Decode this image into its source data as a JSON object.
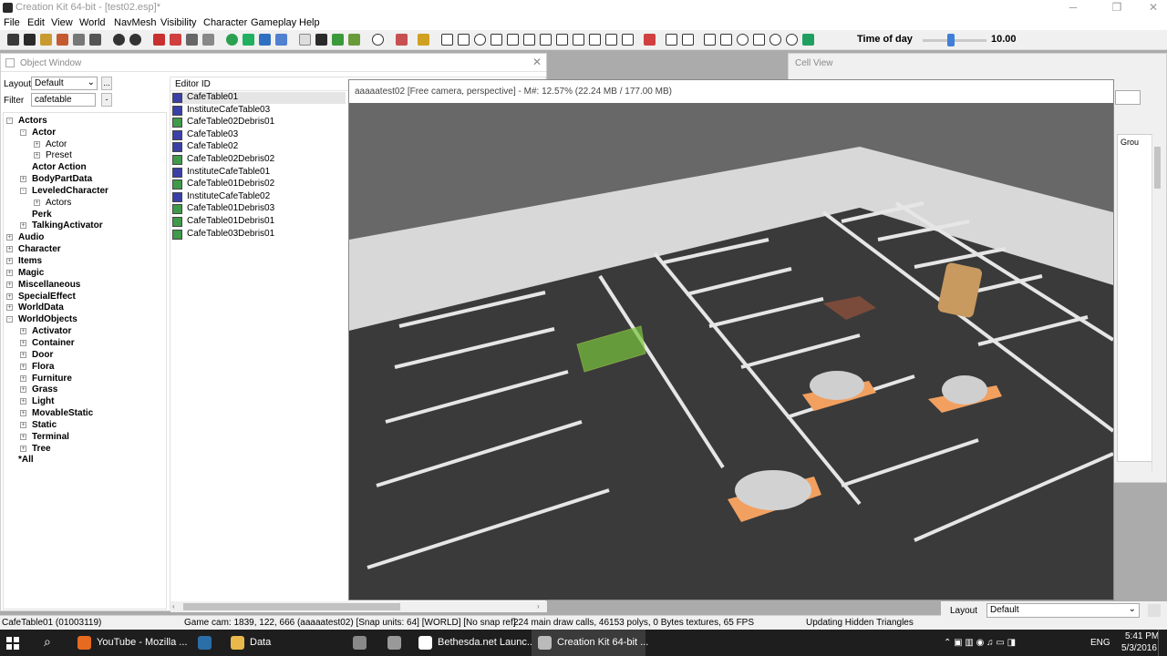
{
  "window": {
    "title": "Creation Kit 64-bit - [test02.esp]*",
    "minimize": "─",
    "maximize": "❐",
    "close": "✕"
  },
  "menu": [
    "File",
    "Edit",
    "View",
    "World",
    "NavMesh",
    "Visibility",
    "Character",
    "Gameplay",
    "Help"
  ],
  "toolbar": {
    "time_label": "Time of day",
    "time_value": "10.00",
    "time_fraction": 0.43
  },
  "object_window": {
    "title": "Object Window",
    "close": "✕",
    "layout_label": "Layout",
    "layout_value": "Default",
    "filter_label": "Filter",
    "filter_value": "cafetable",
    "more_btn": "...",
    "minus_btn": "-",
    "column_header": "Editor ID",
    "tree": [
      {
        "label": "Actors",
        "level": 0,
        "exp": "-",
        "bold": true
      },
      {
        "label": "Actor",
        "level": 1,
        "exp": "-",
        "bold": true
      },
      {
        "label": "Actor",
        "level": 2,
        "exp": "+",
        "bold": false
      },
      {
        "label": "Preset",
        "level": 2,
        "exp": "+",
        "bold": false
      },
      {
        "label": "Actor Action",
        "level": 1,
        "exp": "",
        "bold": true
      },
      {
        "label": "BodyPartData",
        "level": 1,
        "exp": "+",
        "bold": true
      },
      {
        "label": "LeveledCharacter",
        "level": 1,
        "exp": "-",
        "bold": true
      },
      {
        "label": "Actors",
        "level": 2,
        "exp": "+",
        "bold": false
      },
      {
        "label": "Perk",
        "level": 1,
        "exp": "",
        "bold": true
      },
      {
        "label": "TalkingActivator",
        "level": 1,
        "exp": "+",
        "bold": true
      },
      {
        "label": "Audio",
        "level": 0,
        "exp": "+",
        "bold": true
      },
      {
        "label": "Character",
        "level": 0,
        "exp": "+",
        "bold": true
      },
      {
        "label": "Items",
        "level": 0,
        "exp": "+",
        "bold": true
      },
      {
        "label": "Magic",
        "level": 0,
        "exp": "+",
        "bold": true
      },
      {
        "label": "Miscellaneous",
        "level": 0,
        "exp": "+",
        "bold": true
      },
      {
        "label": "SpecialEffect",
        "level": 0,
        "exp": "+",
        "bold": true
      },
      {
        "label": "WorldData",
        "level": 0,
        "exp": "+",
        "bold": true
      },
      {
        "label": "WorldObjects",
        "level": 0,
        "exp": "-",
        "bold": true
      },
      {
        "label": "Activator",
        "level": 1,
        "exp": "+",
        "bold": true
      },
      {
        "label": "Container",
        "level": 1,
        "exp": "+",
        "bold": true
      },
      {
        "label": "Door",
        "level": 1,
        "exp": "+",
        "bold": true
      },
      {
        "label": "Flora",
        "level": 1,
        "exp": "+",
        "bold": true
      },
      {
        "label": "Furniture",
        "level": 1,
        "exp": "+",
        "bold": true
      },
      {
        "label": "Grass",
        "level": 1,
        "exp": "+",
        "bold": true
      },
      {
        "label": "Light",
        "level": 1,
        "exp": "+",
        "bold": true
      },
      {
        "label": "MovableStatic",
        "level": 1,
        "exp": "+",
        "bold": true
      },
      {
        "label": "Static",
        "level": 1,
        "exp": "+",
        "bold": true
      },
      {
        "label": "Terminal",
        "level": 1,
        "exp": "+",
        "bold": true
      },
      {
        "label": "Tree",
        "level": 1,
        "exp": "+",
        "bold": true
      },
      {
        "label": "*All",
        "level": 0,
        "exp": "",
        "bold": true
      }
    ],
    "rows": [
      {
        "label": "CafeTable01",
        "icon": "#3b3fa8"
      },
      {
        "label": "InstituteCafeTable03",
        "icon": "#3b3fa8"
      },
      {
        "label": "CafeTable02Debris01",
        "icon": "#3f9a4a"
      },
      {
        "label": "CafeTable03",
        "icon": "#3b3fa8"
      },
      {
        "label": "CafeTable02",
        "icon": "#3b3fa8"
      },
      {
        "label": "CafeTable02Debris02",
        "icon": "#3f9a4a"
      },
      {
        "label": "InstituteCafeTable01",
        "icon": "#3b3fa8"
      },
      {
        "label": "CafeTable01Debris02",
        "icon": "#3f9a4a"
      },
      {
        "label": "InstituteCafeTable02",
        "icon": "#3b3fa8"
      },
      {
        "label": "CafeTable01Debris03",
        "icon": "#3f9a4a"
      },
      {
        "label": "CafeTable01Debris01",
        "icon": "#3f9a4a"
      },
      {
        "label": "CafeTable03Debris01",
        "icon": "#3f9a4a"
      }
    ]
  },
  "cell_view": {
    "title": "Cell View",
    "column": "Grou"
  },
  "render_window": {
    "title": "aaaaatest02 [Free camera, perspective] - M#: 12.57% (22.24 MB / 177.00 MB)"
  },
  "layout_panel": {
    "label": "Layout",
    "value": "Default"
  },
  "status": {
    "selected": "CafeTable01 (01003119)",
    "camera": "Game cam: 1839, 122, 666 (aaaaatest02) [Snap units: 64] [WORLD] [No snap ref]",
    "stats": "224 main draw calls, 46153 polys, 0 Bytes textures, 65 FPS",
    "activity": "Updating Hidden Triangles"
  },
  "taskbar": {
    "items": [
      {
        "label": "YouTube - Mozilla ...",
        "icon": "#e66a1f",
        "active": false
      },
      {
        "label": "",
        "icon": "#2b6fa8",
        "active": false
      },
      {
        "label": "Data",
        "icon": "#e8b84a",
        "active": false
      },
      {
        "label": "",
        "icon": "#888888",
        "active": false
      },
      {
        "label": "",
        "icon": "#999999",
        "active": false
      },
      {
        "label": "Bethesda.net Launc...",
        "icon": "#ffffff",
        "active": false
      },
      {
        "label": "Creation Kit 64-bit ...",
        "icon": "#bbbbbb",
        "active": true
      }
    ],
    "lang": "ENG",
    "time": "5:41 PM",
    "date": "5/3/2016"
  },
  "colors": {
    "workspace": "#ababab",
    "render_bg": "#6b6b6b",
    "taskbar": "#1e1e1e",
    "selection_green": "#78c43c",
    "marker_orange": "#f2a060"
  }
}
